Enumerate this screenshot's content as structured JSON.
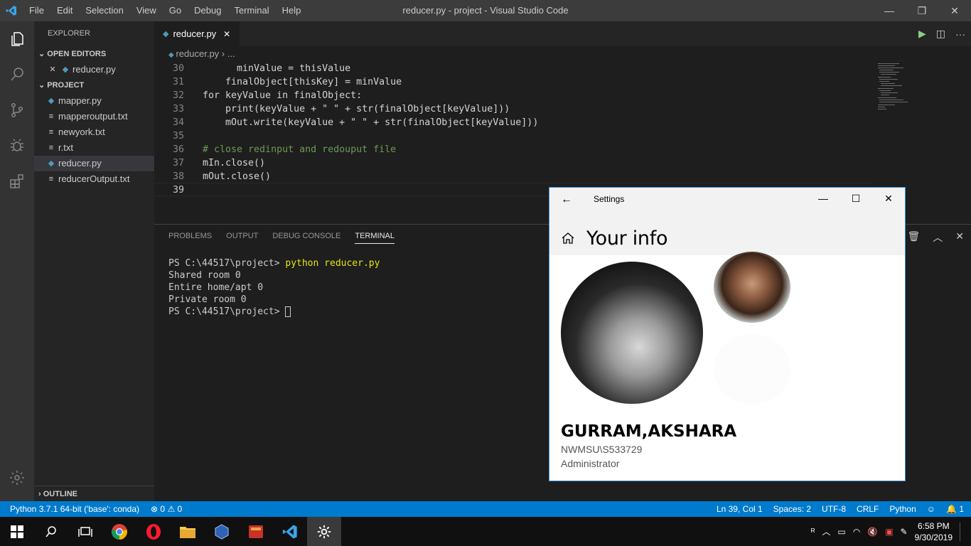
{
  "window": {
    "title": "reducer.py - project - Visual Studio Code",
    "menu": [
      "File",
      "Edit",
      "Selection",
      "View",
      "Go",
      "Debug",
      "Terminal",
      "Help"
    ]
  },
  "sidebar": {
    "header": "EXPLORER",
    "open_editors_label": "OPEN EDITORS",
    "open_editors": [
      {
        "name": "reducer.py",
        "icon": "python-icon"
      }
    ],
    "project_label": "PROJECT",
    "files": [
      {
        "name": "mapper.py",
        "icon": "python-icon"
      },
      {
        "name": "mapperoutput.txt",
        "icon": "text-file-icon"
      },
      {
        "name": "newyork.txt",
        "icon": "text-file-icon"
      },
      {
        "name": "r.txt",
        "icon": "text-file-icon"
      },
      {
        "name": "reducer.py",
        "icon": "python-icon",
        "selected": true
      },
      {
        "name": "reducerOutput.txt",
        "icon": "text-file-icon"
      }
    ],
    "outline_label": "OUTLINE"
  },
  "editor": {
    "tab_label": "reducer.py",
    "breadcrumb_file": "reducer.py",
    "breadcrumb_more": "...",
    "lines": [
      {
        "num": "30",
        "text": "      minValue = thisValue"
      },
      {
        "num": "31",
        "text": "    finalObject[thisKey] = minValue"
      },
      {
        "num": "32",
        "text": "for keyValue in finalObject:"
      },
      {
        "num": "33",
        "text": "    print(keyValue + \" \" + str(finalObject[keyValue]))"
      },
      {
        "num": "34",
        "text": "    mOut.write(keyValue + \" \" + str(finalObject[keyValue]))"
      },
      {
        "num": "35",
        "text": ""
      },
      {
        "num": "36",
        "text": "# close redinput and redouput file"
      },
      {
        "num": "37",
        "text": "mIn.close()"
      },
      {
        "num": "38",
        "text": "mOut.close()"
      },
      {
        "num": "39",
        "text": ""
      }
    ]
  },
  "panel": {
    "tabs": [
      "PROBLEMS",
      "OUTPUT",
      "DEBUG CONSOLE",
      "TERMINAL"
    ],
    "active_tab": "TERMINAL",
    "terminal": {
      "prompt": "PS C:\\44517\\project> ",
      "command": "python reducer.py",
      "output": [
        "Shared room 0",
        "Entire home/apt 0",
        "Private room 0"
      ]
    }
  },
  "status": {
    "interpreter": "Python 3.7.1 64-bit ('base': conda)",
    "errors": "0",
    "warnings": "0",
    "position": "Ln 39, Col 1",
    "spaces": "Spaces: 2",
    "encoding": "UTF-8",
    "eol": "CRLF",
    "language": "Python",
    "notifications": "1"
  },
  "settings_window": {
    "title": "Settings",
    "heading": "Your info",
    "user_name": "GURRAM,AKSHARA",
    "account": "NWMSU\\S533729",
    "role": "Administrator"
  },
  "taskbar": {
    "time": "6:58 PM",
    "date": "9/30/2019",
    "apps": [
      "start-icon",
      "search-icon",
      "task-view-icon",
      "chrome-icon",
      "opera-icon",
      "file-explorer-icon",
      "virtualbox-icon",
      "app-icon",
      "vscode-icon",
      "settings-icon"
    ]
  },
  "colors": {
    "accent": "#007acc",
    "editor_bg": "#1e1e1e",
    "sidebar_bg": "#252526",
    "activity_bg": "#333333"
  }
}
